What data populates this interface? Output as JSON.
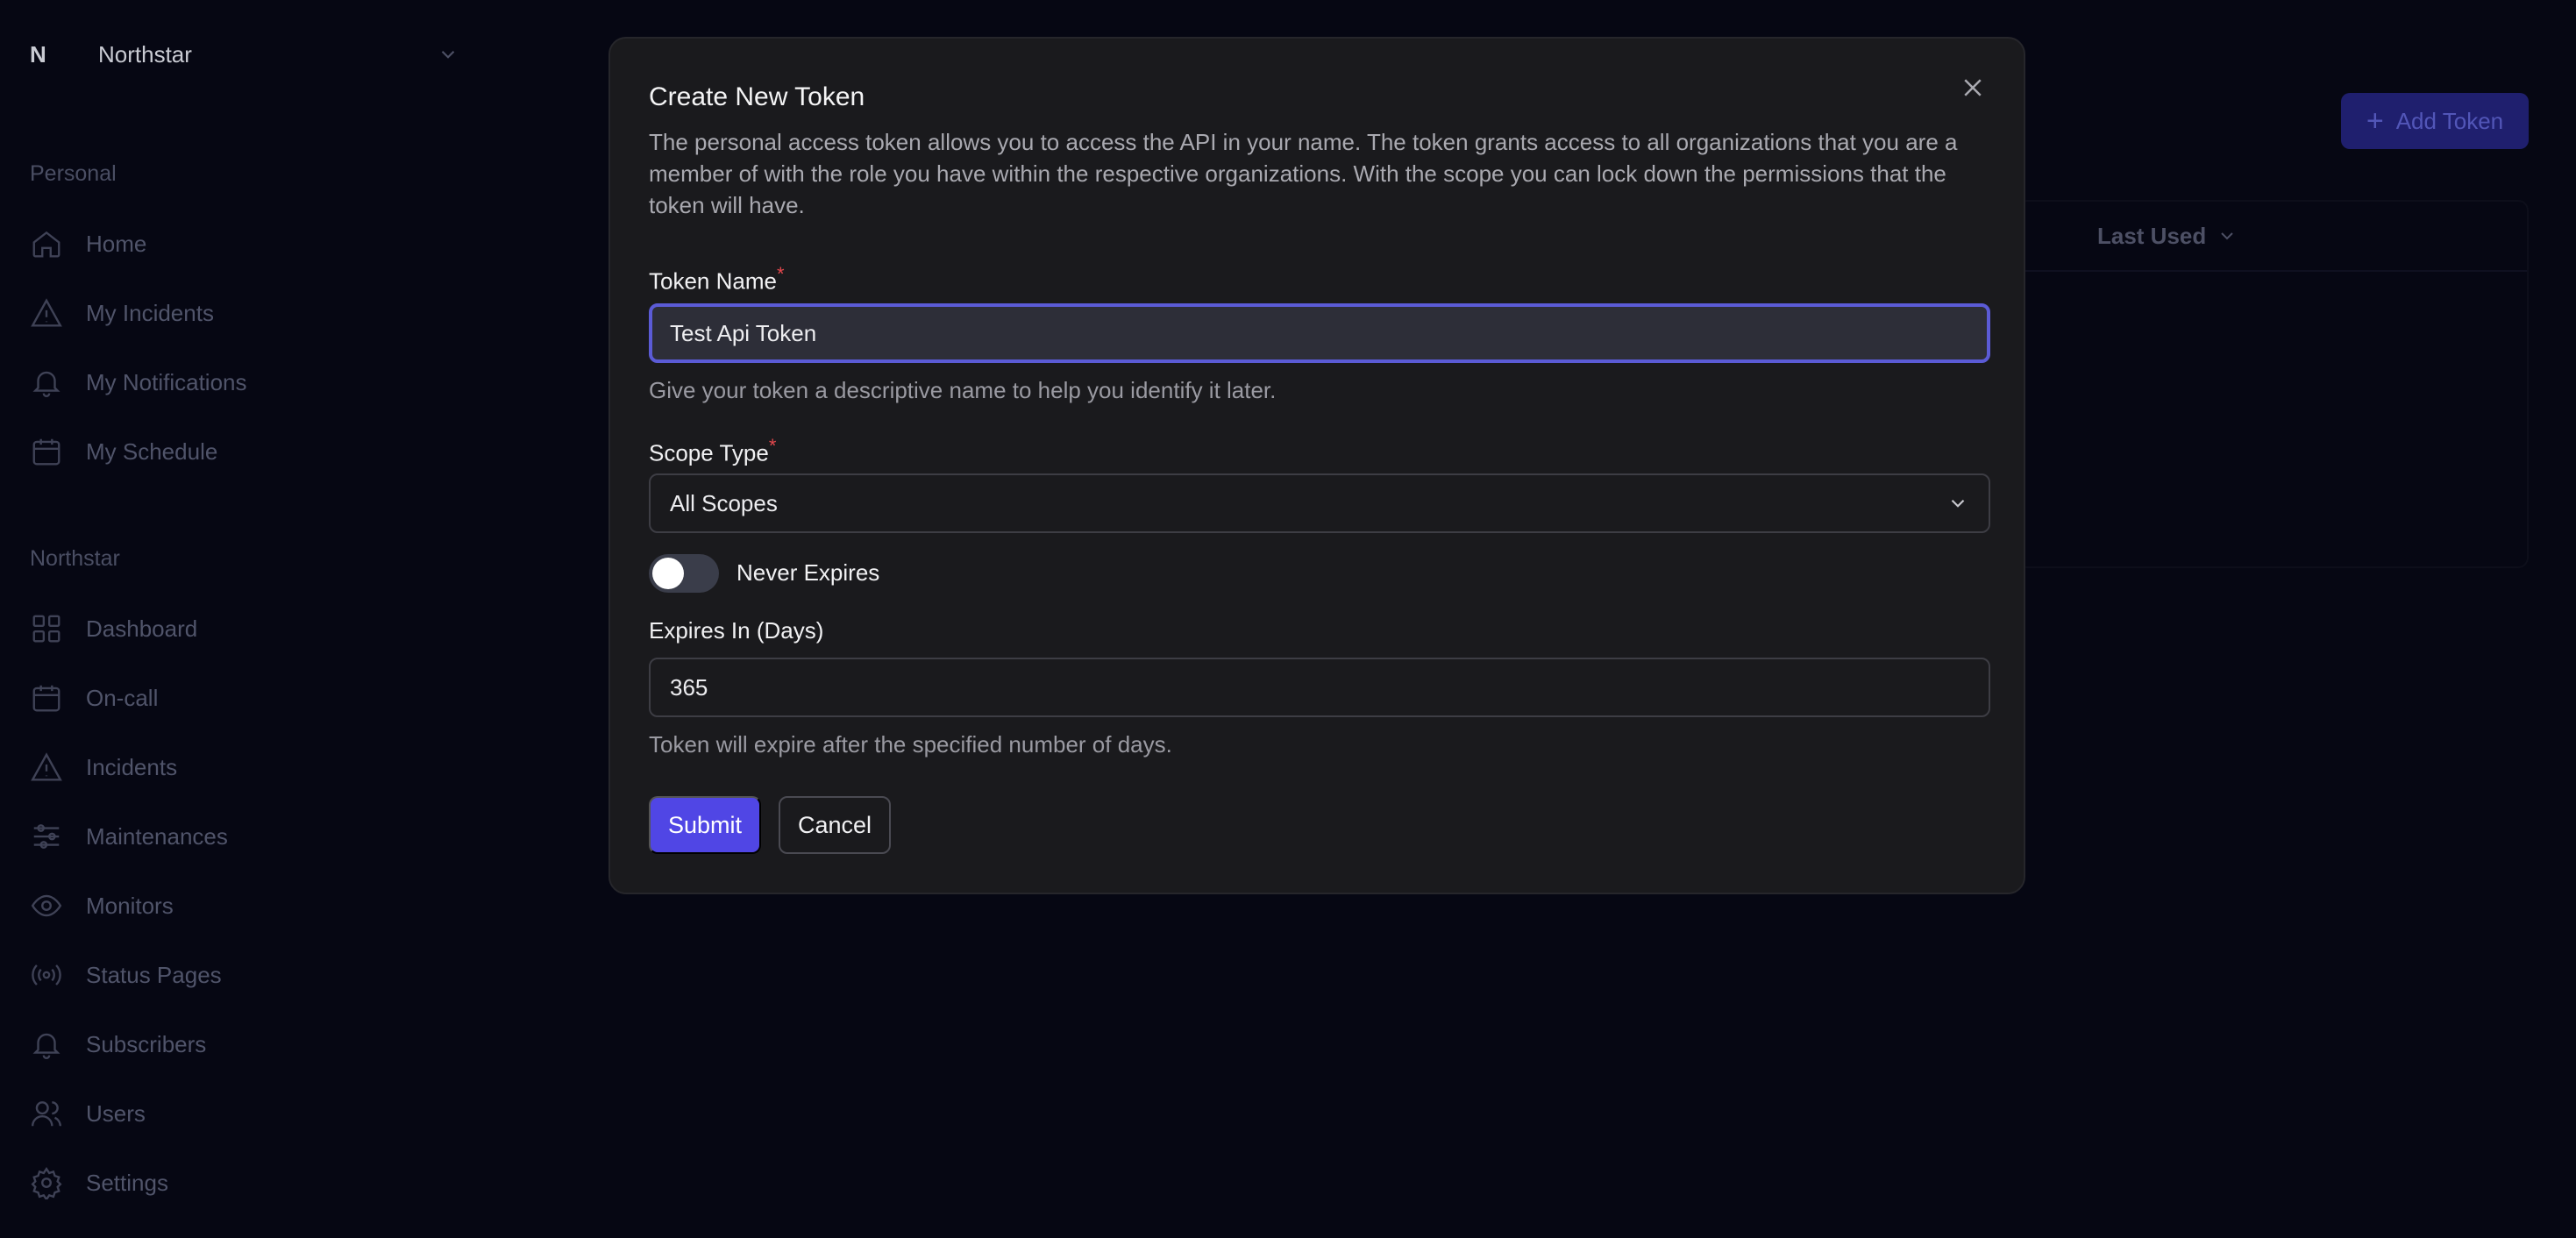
{
  "org": {
    "initial": "N",
    "name": "Northstar"
  },
  "sidebar": {
    "personal_label": "Personal",
    "personal_items": [
      {
        "label": "Home",
        "icon": "home-icon"
      },
      {
        "label": "My Incidents",
        "icon": "alert-triangle-icon"
      },
      {
        "label": "My Notifications",
        "icon": "bell-icon"
      },
      {
        "label": "My Schedule",
        "icon": "calendar-icon"
      }
    ],
    "org_label": "Northstar",
    "org_items": [
      {
        "label": "Dashboard",
        "icon": "grid-icon"
      },
      {
        "label": "On-call",
        "icon": "calendar-icon"
      },
      {
        "label": "Incidents",
        "icon": "alert-triangle-icon"
      },
      {
        "label": "Maintenances",
        "icon": "sliders-icon"
      },
      {
        "label": "Monitors",
        "icon": "eye-icon"
      },
      {
        "label": "Status Pages",
        "icon": "broadcast-icon"
      },
      {
        "label": "Subscribers",
        "icon": "bell-icon"
      },
      {
        "label": "Users",
        "icon": "users-icon"
      },
      {
        "label": "Settings",
        "icon": "gear-icon"
      }
    ]
  },
  "background": {
    "add_token_label": "Add Token",
    "table_header_last_used": "Last Used"
  },
  "modal": {
    "title": "Create New Token",
    "description": "The personal access token allows you to access the API in your name. The token grants access to all organizations that you are a member of with the role you have within the respective organizations. With the scope you can lock down the permissions that the token will have.",
    "token_name_label": "Token Name",
    "token_name_value": "Test Api Token",
    "token_name_help": "Give your token a descriptive name to help you identify it later.",
    "scope_type_label": "Scope Type",
    "scope_type_value": "All Scopes",
    "never_expires_label": "Never Expires",
    "never_expires_on": false,
    "expires_label": "Expires In (Days)",
    "expires_value": "365",
    "expires_help": "Token will expire after the specified number of days.",
    "submit_label": "Submit",
    "cancel_label": "Cancel",
    "required_marker": "*"
  },
  "colors": {
    "accent": "#5046e5",
    "focus_ring": "#5b5bd6",
    "required": "#e5484d",
    "modal_bg": "#1a1a1d",
    "page_bg": "#060713"
  }
}
